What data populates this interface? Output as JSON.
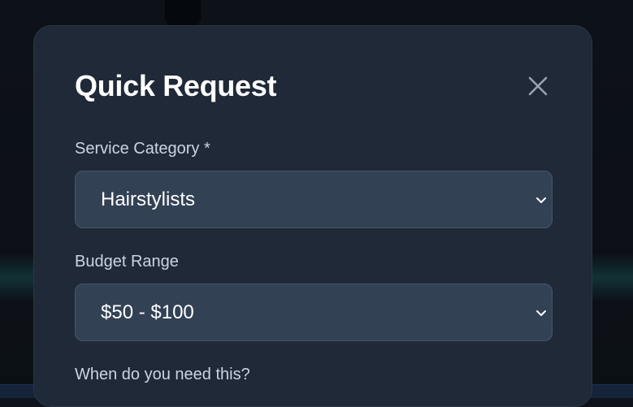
{
  "modal": {
    "title": "Quick Request",
    "close_icon": "close-icon"
  },
  "fields": {
    "service_category": {
      "label": "Service Category *",
      "value": "Hairstylists",
      "icon": "chevron-down-icon"
    },
    "budget_range": {
      "label": "Budget Range",
      "value": "$50 - $100",
      "icon": "chevron-down-icon"
    },
    "timing": {
      "label": "When do you need this?"
    }
  },
  "colors": {
    "modal_bg": "#1f2937",
    "select_bg": "#334155",
    "select_border": "#475569",
    "label": "#cbd5e1",
    "text": "#ffffff",
    "close_icon": "#9ca3af"
  }
}
